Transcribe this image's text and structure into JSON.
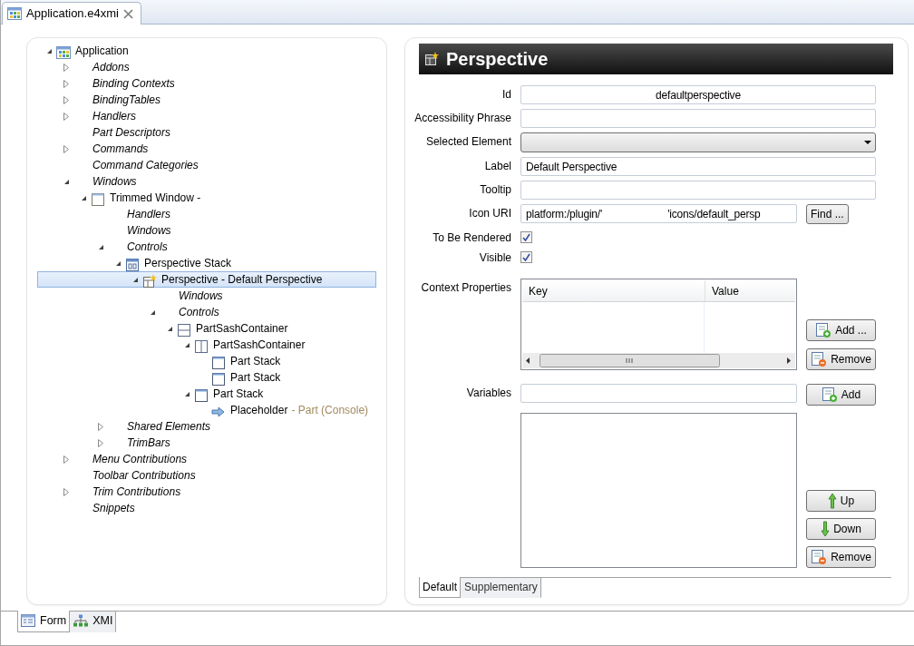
{
  "editor_tab": {
    "title": "Application.e4xmi"
  },
  "tree": [
    {
      "label": "Application",
      "kind": "application",
      "expanded": true,
      "selected": false,
      "children": [
        {
          "label": "Addons",
          "kind": "folder",
          "expanded": false,
          "selected": false
        },
        {
          "label": "Binding Contexts",
          "kind": "folder",
          "expanded": false,
          "selected": false
        },
        {
          "label": "BindingTables",
          "kind": "folder",
          "expanded": false,
          "selected": false
        },
        {
          "label": "Handlers",
          "kind": "folder",
          "expanded": false,
          "selected": false
        },
        {
          "label": "Part Descriptors",
          "kind": "folder",
          "selected": false
        },
        {
          "label": "Commands",
          "kind": "folder",
          "expanded": false,
          "selected": false
        },
        {
          "label": "Command Categories",
          "kind": "folder",
          "selected": false
        },
        {
          "label": "Windows",
          "kind": "folder",
          "expanded": true,
          "selected": false,
          "children": [
            {
              "label": "Trimmed Window -",
              "kind": "window",
              "expanded": true,
              "selected": false,
              "children": [
                {
                  "label": "Handlers",
                  "kind": "folder",
                  "selected": false
                },
                {
                  "label": "Windows",
                  "kind": "folder",
                  "selected": false
                },
                {
                  "label": "Controls",
                  "kind": "folder",
                  "expanded": true,
                  "selected": false,
                  "children": [
                    {
                      "label": "Perspective Stack",
                      "kind": "perspective-stack",
                      "expanded": true,
                      "selected": false,
                      "children": [
                        {
                          "label": "Perspective - Default Perspective",
                          "kind": "perspective",
                          "expanded": true,
                          "selected": true,
                          "children": [
                            {
                              "label": "Windows",
                              "kind": "folder",
                              "selected": false
                            },
                            {
                              "label": "Controls",
                              "kind": "folder",
                              "expanded": true,
                              "selected": false,
                              "children": [
                                {
                                  "label": "PartSashContainer",
                                  "kind": "sash-horizontal",
                                  "expanded": true,
                                  "selected": false,
                                  "children": [
                                    {
                                      "label": "PartSashContainer",
                                      "kind": "sash-vertical",
                                      "expanded": true,
                                      "selected": false,
                                      "children": [
                                        {
                                          "label": "Part Stack",
                                          "kind": "part-stack",
                                          "selected": false
                                        },
                                        {
                                          "label": "Part Stack",
                                          "kind": "part-stack",
                                          "selected": false
                                        }
                                      ]
                                    },
                                    {
                                      "label": "Part Stack",
                                      "kind": "part-stack",
                                      "expanded": true,
                                      "selected": false,
                                      "children": [
                                        {
                                          "label": "Placeholder",
                                          "suffix": "- Part (Console)",
                                          "kind": "placeholder",
                                          "selected": false
                                        }
                                      ]
                                    }
                                  ]
                                }
                              ]
                            }
                          ]
                        }
                      ]
                    }
                  ]
                },
                {
                  "label": "Shared Elements",
                  "kind": "folder",
                  "expanded": false,
                  "selected": false
                },
                {
                  "label": "TrimBars",
                  "kind": "folder",
                  "expanded": false,
                  "selected": false
                }
              ]
            }
          ]
        },
        {
          "label": "Menu Contributions",
          "kind": "folder",
          "expanded": false,
          "selected": false
        },
        {
          "label": "Toolbar Contributions",
          "kind": "folder",
          "selected": false
        },
        {
          "label": "Trim Contributions",
          "kind": "folder",
          "expanded": false,
          "selected": false
        },
        {
          "label": "Snippets",
          "kind": "folder",
          "selected": false
        }
      ]
    }
  ],
  "header": {
    "title": "Perspective"
  },
  "fields": [
    {
      "kind": "text",
      "label": "Id",
      "value": "defaultperspective",
      "centered": true
    },
    {
      "kind": "text",
      "label": "Accessibility Phrase"
    },
    {
      "kind": "combo",
      "label": "Selected Element"
    },
    {
      "kind": "text",
      "label": "Label",
      "value": "Default Perspective"
    },
    {
      "kind": "text",
      "label": "Tooltip"
    },
    {
      "kind": "uri",
      "label": "Icon URI",
      "value": "platform:/plugin/'                       'icons/default_persp",
      "button": "Find ..."
    },
    {
      "kind": "checkbox",
      "label": "To Be Rendered",
      "checked": true
    },
    {
      "kind": "checkbox",
      "label": "Visible",
      "checked": true
    }
  ],
  "context_properties": {
    "label": "Context Properties",
    "columns": [
      "Key",
      "Value"
    ],
    "buttons": [
      {
        "label": "Add ...",
        "kind": "add"
      },
      {
        "label": "Remove",
        "kind": "remove"
      }
    ]
  },
  "variables": {
    "label": "Variables",
    "add_button": {
      "label": "Add",
      "kind": "add"
    },
    "buttons": [
      {
        "label": "Up",
        "kind": "up"
      },
      {
        "label": "Down",
        "kind": "down"
      },
      {
        "label": "Remove",
        "kind": "remove"
      }
    ]
  },
  "form_tabs": [
    {
      "label": "Default",
      "selected": true
    },
    {
      "label": "Supplementary",
      "selected": false
    }
  ],
  "editor_tabs": [
    {
      "label": "Form",
      "kind": "form",
      "selected": true
    },
    {
      "label": "XMI",
      "kind": "xmi",
      "selected": false
    }
  ]
}
